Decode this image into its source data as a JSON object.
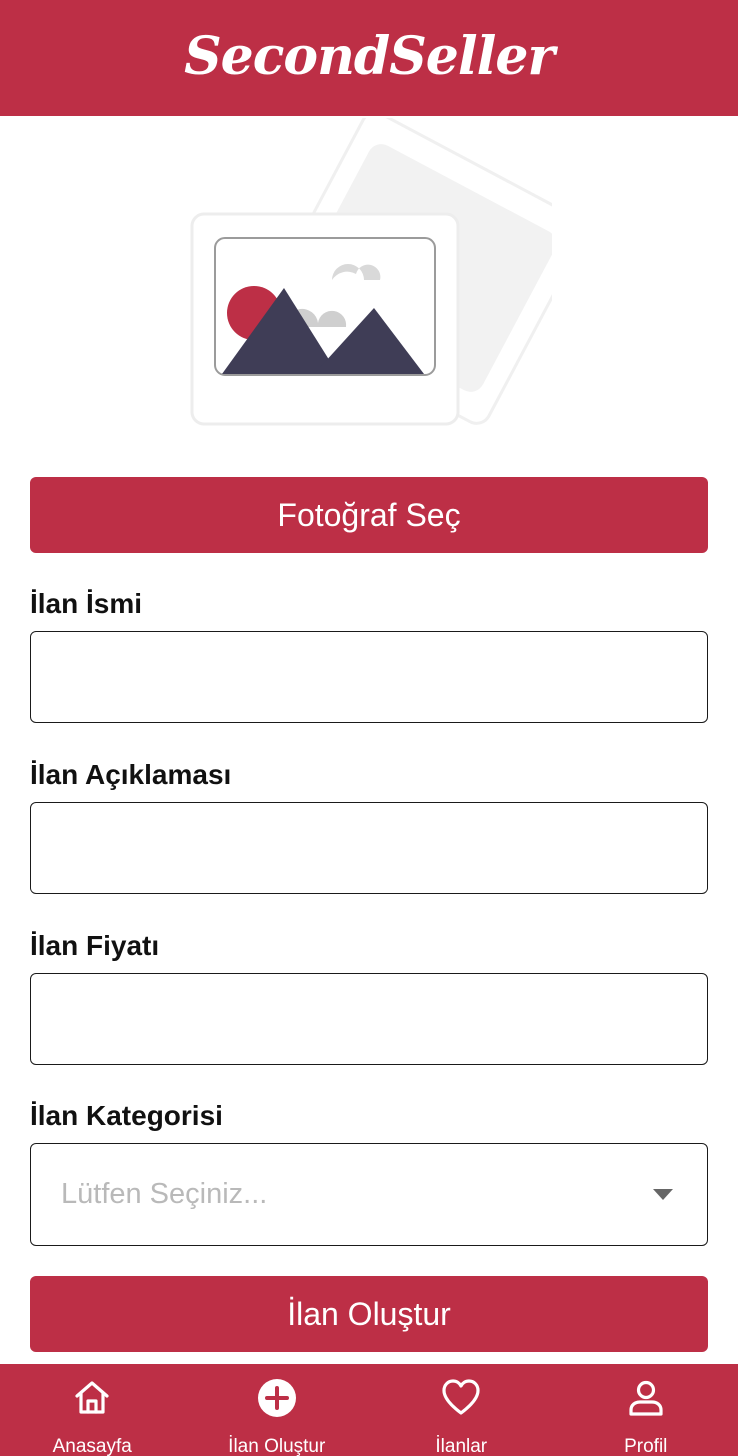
{
  "header": {
    "brand": "SecondSeller"
  },
  "illustration": {
    "icon": "image-placeholder-icon"
  },
  "form": {
    "photo_button": "Fotoğraf Seç",
    "name_label": "İlan İsmi",
    "name_value": "",
    "description_label": "İlan Açıklaması",
    "description_value": "",
    "price_label": "İlan Fiyatı",
    "price_value": "",
    "category_label": "İlan Kategorisi",
    "category_placeholder": "Lütfen Seçiniz...",
    "submit_button": "İlan Oluştur"
  },
  "nav": {
    "items": [
      {
        "label": "Anasayfa",
        "icon": "home-icon"
      },
      {
        "label": "İlan Oluştur",
        "icon": "plus-circle-icon"
      },
      {
        "label": "İlanlar",
        "icon": "heart-icon"
      },
      {
        "label": "Profil",
        "icon": "user-icon"
      }
    ]
  },
  "colors": {
    "brand": "#bd2f46",
    "illustration_dark": "#3f3d56",
    "placeholder_text": "#b9b9b9"
  }
}
